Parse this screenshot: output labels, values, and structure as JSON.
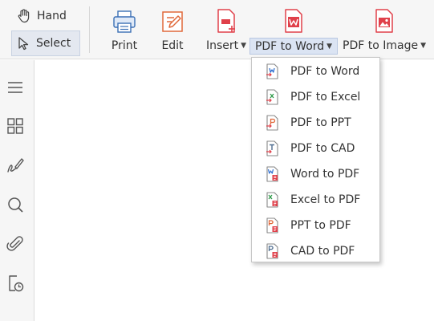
{
  "toolbar": {
    "hand_label": "Hand",
    "select_label": "Select",
    "tools": [
      {
        "label": "Print",
        "icon": "printer-icon"
      },
      {
        "label": "Edit",
        "icon": "edit-icon"
      },
      {
        "label": "Insert",
        "icon": "insert-page-icon"
      },
      {
        "label": "PDF to Word",
        "icon": "pdf-to-word-icon"
      },
      {
        "label": "PDF to Image",
        "icon": "pdf-to-image-icon"
      }
    ]
  },
  "sidebar": {
    "items": [
      "menu-icon",
      "thumbnails-icon",
      "signature-icon",
      "search-icon",
      "attachment-icon",
      "history-icon"
    ]
  },
  "dropdown": {
    "items": [
      {
        "label": "PDF to Word",
        "icon": "pdf-to-word-icon"
      },
      {
        "label": "PDF to Excel",
        "icon": "pdf-to-excel-icon"
      },
      {
        "label": "PDF to PPT",
        "icon": "pdf-to-ppt-icon"
      },
      {
        "label": "PDF to CAD",
        "icon": "pdf-to-cad-icon"
      },
      {
        "label": "Word to PDF",
        "icon": "word-to-pdf-icon"
      },
      {
        "label": "Excel to PDF",
        "icon": "excel-to-pdf-icon"
      },
      {
        "label": "PPT to PDF",
        "icon": "ppt-to-pdf-icon"
      },
      {
        "label": "CAD to PDF",
        "icon": "cad-to-pdf-icon"
      }
    ]
  },
  "colors": {
    "accent_red": "#e0404a",
    "word_blue": "#2f6fd0",
    "excel_green": "#2f9a4a",
    "ppt_orange": "#e0683a",
    "cad_slate": "#4f6d90"
  }
}
